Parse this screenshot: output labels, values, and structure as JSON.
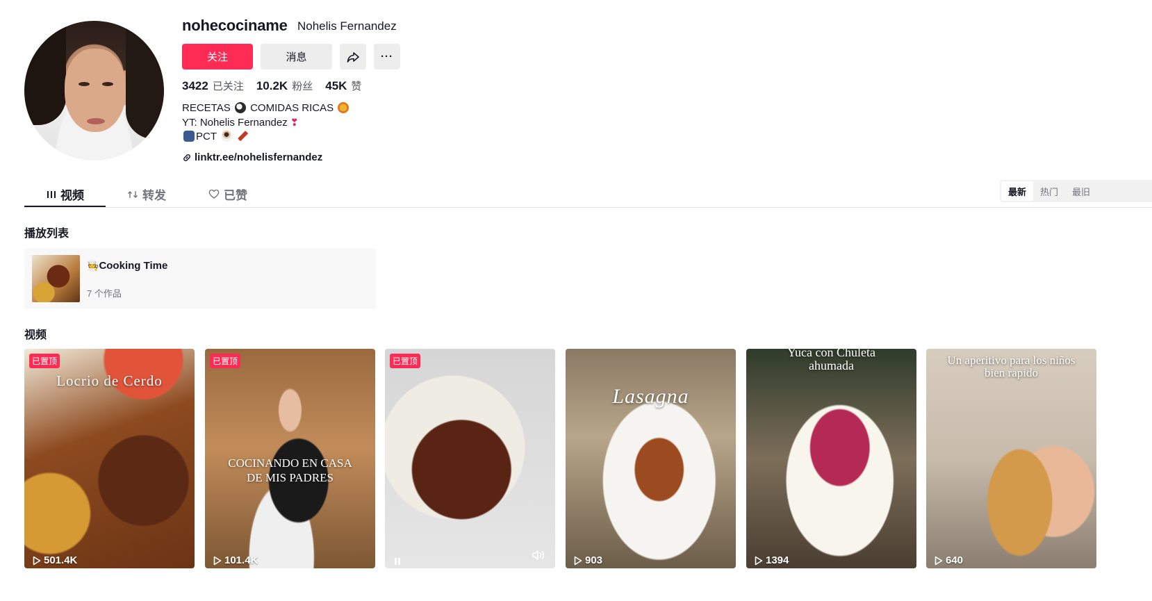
{
  "profile": {
    "username": "nohecociname",
    "nickname": "Nohelis Fernandez",
    "follow_label": "关注",
    "message_label": "消息",
    "more_label": "···"
  },
  "stats": {
    "following_count": "3422",
    "following_label": "已关注",
    "followers_count": "10.2K",
    "followers_label": "粉丝",
    "likes_count": "45K",
    "likes_label": "赞"
  },
  "bio": {
    "line1_a": "RECETAS",
    "line1_b": "COMIDAS RICAS",
    "line2": "YT: Nohelis Fernandez",
    "line3": "PCT",
    "link": "linktr.ee/nohelisfernandez"
  },
  "tabs": [
    {
      "label": "视频"
    },
    {
      "label": "转发"
    },
    {
      "label": "已赞"
    }
  ],
  "sort": [
    "最新",
    "热门",
    "最旧"
  ],
  "sections": {
    "playlists_title": "播放列表",
    "videos_title": "视频"
  },
  "playlist": {
    "name": "Cooking Time",
    "count": "7 个作品"
  },
  "videos": [
    {
      "pinned": "已置顶",
      "views": "501.4K",
      "overlay": "Locrio de Cerdo"
    },
    {
      "pinned": "已置顶",
      "views": "101.4K",
      "overlay": "COCINANDO EN CASA DE MIS PADRES"
    },
    {
      "pinned": "已置顶",
      "views": "",
      "overlay": ""
    },
    {
      "pinned": "",
      "views": "903",
      "overlay": "Lasagna"
    },
    {
      "pinned": "",
      "views": "1394",
      "overlay": "Yuca con Chuleta ahumada"
    },
    {
      "pinned": "",
      "views": "640",
      "overlay": "Un aperitivo para los niños bien rapido"
    }
  ],
  "colors": {
    "accent": "#fe2c55",
    "text": "#161823",
    "muted": "#73747b"
  }
}
